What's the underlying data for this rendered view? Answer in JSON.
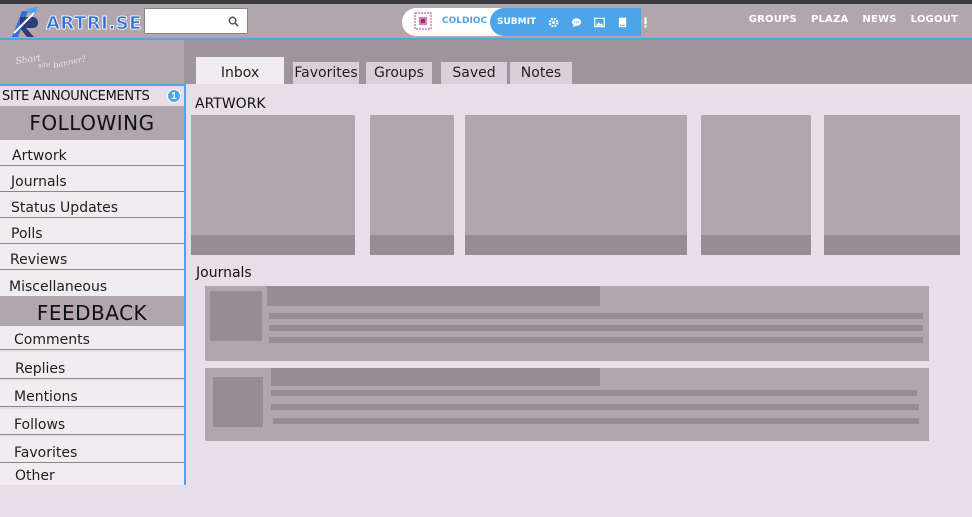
{
  "header": {
    "logo_text": "ARTRI.SE",
    "search_placeholder": "",
    "user_name": "COLDIOC",
    "submit_label": "SUBMIT",
    "action_icons": [
      "gear-icon",
      "chat-icon",
      "image-icon",
      "book-icon",
      "alert-icon"
    ],
    "nav": [
      "GROUPS",
      "PLAZA",
      "NEWS",
      "LOGOUT"
    ],
    "accent_color": "#4ea4e8"
  },
  "banner": {
    "doodle_text": "Short site banner?"
  },
  "tabs": [
    "Inbox",
    "Favorites",
    "Groups",
    "Saved",
    "Notes"
  ],
  "sidebar": {
    "announcements_label": "SITE ANNOUNCEMENTS",
    "announcements_count": "1",
    "following_title": "FOLLOWING",
    "following_items": [
      "Artwork",
      "Journals",
      "Status Updates",
      "Polls",
      "Reviews",
      "Miscellaneous"
    ],
    "feedback_title": "FEEDBACK",
    "feedback_items": [
      "Comments",
      "Replies",
      "Mentions",
      "Follows",
      "Favorites",
      "Other"
    ]
  },
  "main": {
    "artwork_title": "ARTWORK",
    "journals_title": "Journals"
  }
}
